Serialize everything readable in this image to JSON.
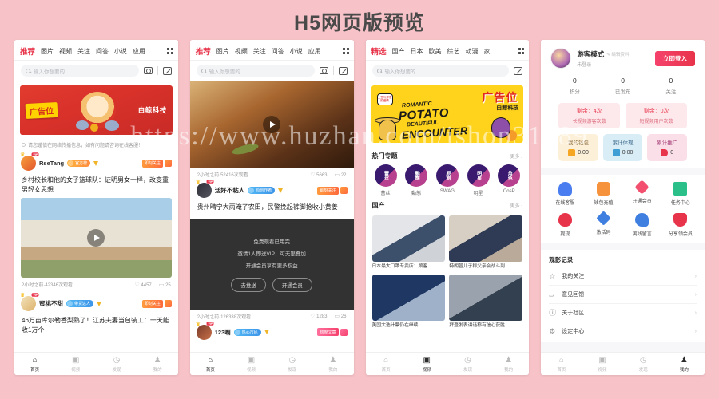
{
  "page": {
    "title": "H5网页版预览",
    "watermark": "https://www.huzhan.com/ishop31889"
  },
  "phone1": {
    "tabs": [
      "推荐",
      "图片",
      "视频",
      "关注",
      "问答",
      "小说",
      "应用"
    ],
    "active_tab": "推荐",
    "search_placeholder": "输入你想要的",
    "ad": {
      "tag": "广告位",
      "brand": "白鲸科技"
    },
    "notice": "请您谨慎在网络传播信息，如有问题请咨询在线客服！",
    "posts": [
      {
        "user": "RseTang",
        "badge": "官方榜",
        "tag": "即刻关注",
        "title": "乡村校长和他的女子篮球队：证明男女一样，改变重男轻女思想",
        "time_views": "2小时之前·42346次观看",
        "likes": "4457",
        "comments": "25"
      },
      {
        "user": "蜜桃不甜",
        "badge": "带货达人",
        "tag": "即刻关注",
        "title": "46万亩库尔勒香梨熟了！江苏夫妻当包装工：一天能收1万个"
      }
    ],
    "bottom_nav": [
      {
        "label": "首页",
        "icon": "home-icon"
      },
      {
        "label": "视频",
        "icon": "video-icon"
      },
      {
        "label": "发现",
        "icon": "compass-icon"
      },
      {
        "label": "我的",
        "icon": "user-icon"
      }
    ]
  },
  "phone2": {
    "tabs": [
      "推荐",
      "图片",
      "视频",
      "关注",
      "问答",
      "小说",
      "应用"
    ],
    "active_tab": "推荐",
    "search_placeholder": "输入你想要的",
    "posts": [
      {
        "time_views": "2小时之前·52416次观看",
        "likes": "5663",
        "comments": "22",
        "user": "活好不粘人",
        "badge": "原创作者",
        "tag": "即刻关注",
        "title": "贵州晴宁大雨淹了农田，民警挽起裤脚抢收小黄姜"
      },
      {
        "time_views": "2小时之前·126338次观看",
        "likes": "1283",
        "comments": "26",
        "user": "123啊",
        "badge": "热心市民",
        "tag": "热度文章"
      }
    ],
    "paywall": {
      "line1": "免费观看已用完",
      "line2": "邀请1人即送VIP，可无限叠加",
      "line3": "开通会员享有更多权益",
      "btn_left": "去推送",
      "btn_right": "开通会员"
    },
    "bottom_nav": [
      {
        "label": "首页",
        "icon": "home-icon"
      },
      {
        "label": "视频",
        "icon": "video-icon"
      },
      {
        "label": "发现",
        "icon": "compass-icon"
      },
      {
        "label": "我的",
        "icon": "user-icon"
      }
    ]
  },
  "phone3": {
    "tabs": [
      "精选",
      "国产",
      "日本",
      "欧美",
      "综艺",
      "动漫",
      "家"
    ],
    "active_tab": "精选",
    "search_placeholder": "输入你想要的",
    "ad": {
      "tag": "广告位",
      "brand": "白鲸科技",
      "line1": "ROMANTIC",
      "line2": "POTATO",
      "line3": "BEAUTIFUL",
      "line4": "ENCOUNTER",
      "speech": "土豆与洋葱的爱情"
    },
    "sections": [
      {
        "title": "热门专题",
        "more": "更多",
        "topics": [
          {
            "circle": "蕾丝",
            "label": "蕾丝"
          },
          {
            "circle": "動態",
            "label": "動態"
          },
          {
            "circle": "原創",
            "label": "SWAG"
          },
          {
            "circle": "明星",
            "label": "明星"
          },
          {
            "circle": "角色",
            "label": "CosP"
          }
        ]
      },
      {
        "title": "国产",
        "more": "更多",
        "videos": [
          {
            "caption": "日本最大口罩专卖店：顾客…"
          },
          {
            "caption": "特朗普儿子称父亲会战斗到…"
          },
          {
            "caption": "美国大选计票仍在继续…"
          },
          {
            "caption": "拜登发表讲话称有信心获胜…"
          }
        ]
      }
    ],
    "bottom_nav": [
      {
        "label": "首页",
        "icon": "home-icon"
      },
      {
        "label": "视频",
        "icon": "video-icon"
      },
      {
        "label": "发现",
        "icon": "compass-icon"
      },
      {
        "label": "我的",
        "icon": "user-icon"
      }
    ]
  },
  "phone4": {
    "user": {
      "name": "游客模式",
      "edit_label": "编辑资料",
      "sub": "未登录",
      "login_button": "立即登入"
    },
    "stats": [
      {
        "value": "0",
        "label": "积分"
      },
      {
        "value": "0",
        "label": "已发布"
      },
      {
        "value": "0",
        "label": "关注"
      }
    ],
    "remaining": [
      {
        "value": "剩余：4次",
        "label": "长视频游客次数"
      },
      {
        "value": "剩余：0次",
        "label": "短视频用户次数"
      }
    ],
    "money": [
      {
        "title": "我的钱包",
        "value": "0.00"
      },
      {
        "title": "累计体现",
        "value": "0.00"
      },
      {
        "title": "累计推广",
        "value": "0"
      }
    ],
    "grid": [
      {
        "label": "在线客服",
        "icon": "headset-icon",
        "color": "#4a7ef0"
      },
      {
        "label": "钱包充值",
        "icon": "wallet-icon",
        "color": "#f5923b"
      },
      {
        "label": "开通会员",
        "icon": "diamond-icon",
        "color": "#f2506e"
      },
      {
        "label": "任务中心",
        "icon": "task-icon",
        "color": "#2bbf8a"
      },
      {
        "label": "提现",
        "icon": "money-bag-icon",
        "color": "#e8344a"
      },
      {
        "label": "激活码",
        "icon": "layers-icon",
        "color": "#3f7fe0"
      },
      {
        "label": "离线留言",
        "icon": "message-icon",
        "color": "#3f7fe0"
      },
      {
        "label": "分享领会员",
        "icon": "gift-icon",
        "color": "#e8344a"
      }
    ],
    "list": {
      "header": "观影记录",
      "items": [
        {
          "label": "我的关注",
          "icon": "star-icon"
        },
        {
          "label": "意见回馈",
          "icon": "feedback-icon"
        },
        {
          "label": "关于社区",
          "icon": "info-icon"
        },
        {
          "label": "设定中心",
          "icon": "gear-icon"
        }
      ]
    },
    "bottom_nav": [
      {
        "label": "首页",
        "icon": "home-icon"
      },
      {
        "label": "视频",
        "icon": "video-icon"
      },
      {
        "label": "发现",
        "icon": "compass-icon"
      },
      {
        "label": "我的",
        "icon": "user-icon"
      }
    ]
  }
}
